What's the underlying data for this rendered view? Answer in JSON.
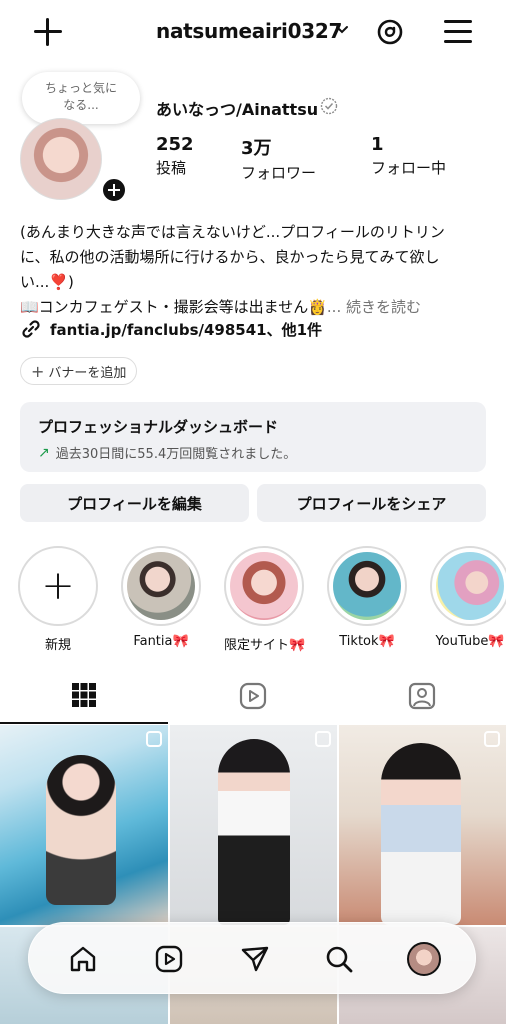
{
  "header": {
    "username": "natsumeairi0327"
  },
  "profile": {
    "note": "ちょっと気に\nなる...",
    "note_line1": "ちょっと気に",
    "note_line2": "なる...",
    "display_name": "あいなっつ/Ainattsu",
    "stats": [
      {
        "value": "252",
        "label": "投稿"
      },
      {
        "value": "3万",
        "label": "フォロワー"
      },
      {
        "value": "1",
        "label": "フォロー中"
      }
    ],
    "bio_line1": "(あんまり大きな声では言えないけど...プロフィールのリトリン",
    "bio_line2": "に、私の他の活動場所に行けるから、良かったら見てみて欲し",
    "bio_line3": "い...❣️)",
    "bio_line4": "📖コンカフェゲスト・撮影会等は出ません👸",
    "bio_more": "... 続きを読む",
    "link": "fantia.jp/fanclubs/498541、他1件",
    "add_banner": "バナーを追加"
  },
  "dashboard": {
    "title": "プロフェッショナルダッシュボード",
    "subtitle": "過去30日間に55.4万回閲覧されました。"
  },
  "actions": {
    "edit": "プロフィールを編集",
    "share": "プロフィールをシェア"
  },
  "highlights": [
    {
      "label": "新規"
    },
    {
      "label": "Fantia🎀"
    },
    {
      "label": "限定サイト🎀"
    },
    {
      "label": "Tiktok🎀"
    },
    {
      "label": "YouTube🎀"
    }
  ],
  "icons": {
    "top": [
      "plus-icon",
      "chevron-down-icon",
      "threads-icon",
      "menu-icon"
    ],
    "tabs": [
      "grid-icon",
      "reels-icon",
      "tagged-icon"
    ],
    "nav": [
      "home-icon",
      "reels-icon",
      "send-icon",
      "search-icon",
      "profile-avatar"
    ]
  },
  "colors": {
    "dashboard_arrow": "#1a9a4a",
    "button_bg": "#eeeff2"
  }
}
